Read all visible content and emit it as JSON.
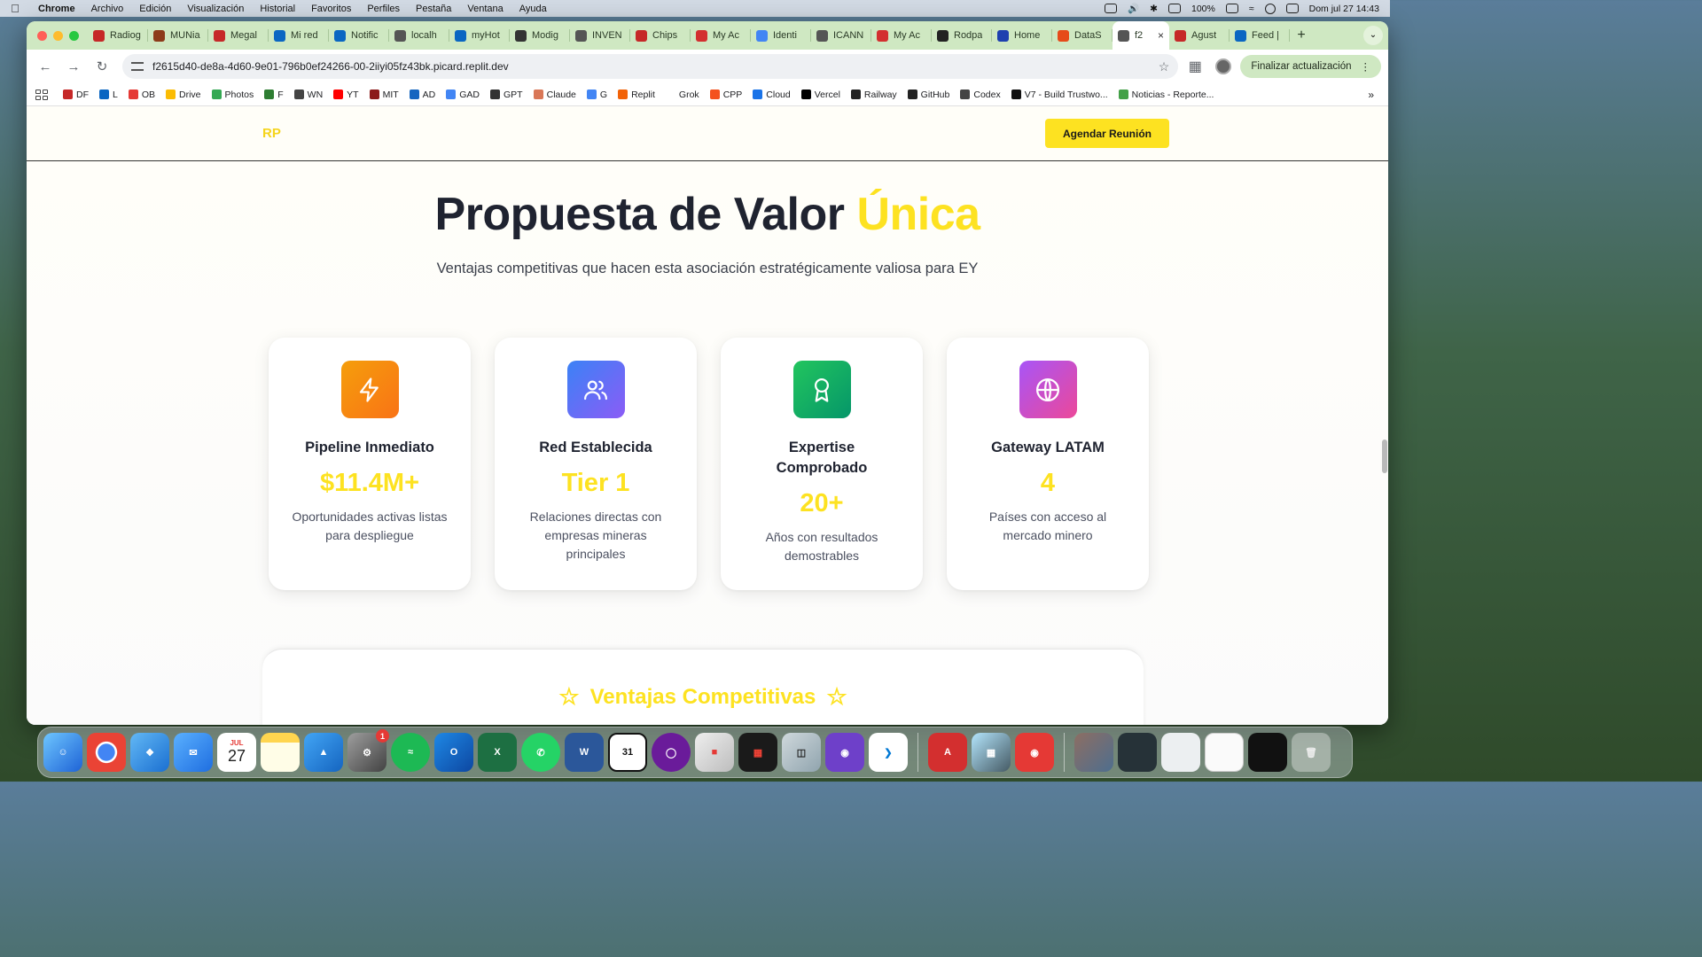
{
  "menubar": {
    "app": "Chrome",
    "items": [
      "Archivo",
      "Edición",
      "Visualización",
      "Historial",
      "Favoritos",
      "Perfiles",
      "Pestaña",
      "Ventana",
      "Ayuda"
    ],
    "battery": "100%",
    "datetime": "Dom jul 27  14:43"
  },
  "tabs": [
    {
      "label": "Radiog",
      "color": "#c62828"
    },
    {
      "label": "MUNia",
      "color": "#8d3b1a"
    },
    {
      "label": "Megal",
      "color": "#c62828"
    },
    {
      "label": "Mi red",
      "color": "#0a66c2"
    },
    {
      "label": "Notific",
      "color": "#0a66c2"
    },
    {
      "label": "localh",
      "color": "#555555"
    },
    {
      "label": "myHot",
      "color": "#0a66c2"
    },
    {
      "label": "Modig",
      "color": "#333333"
    },
    {
      "label": "INVEN",
      "color": "#555555"
    },
    {
      "label": "Chips",
      "color": "#c62828"
    },
    {
      "label": "My Ac",
      "color": "#d32f2f"
    },
    {
      "label": "Identi",
      "color": "#4285f4"
    },
    {
      "label": "ICANN",
      "color": "#555555"
    },
    {
      "label": "My Ac",
      "color": "#d32f2f"
    },
    {
      "label": "Rodpa",
      "color": "#222222"
    },
    {
      "label": "Home",
      "color": "#1e40af"
    },
    {
      "label": "DataS",
      "color": "#e64a19"
    },
    {
      "label": "f2",
      "color": "#555555",
      "active": true
    },
    {
      "label": "Agust",
      "color": "#c62828"
    },
    {
      "label": "Feed |",
      "color": "#0a66c2"
    }
  ],
  "toolbar": {
    "url": "f2615d40-de8a-4d60-9e01-796b0ef24266-00-2iiyi05fz43bk.picard.replit.dev",
    "update_label": "Finalizar actualización"
  },
  "bookmarks": [
    {
      "label": "DF",
      "color": "#c62828"
    },
    {
      "label": "L",
      "color": "#0a66c2"
    },
    {
      "label": "OB",
      "color": "#e53935"
    },
    {
      "label": "Drive",
      "color": "#fbbc04"
    },
    {
      "label": "Photos",
      "color": "#34a853"
    },
    {
      "label": "F",
      "color": "#2e7d32"
    },
    {
      "label": "WN",
      "color": "#444444"
    },
    {
      "label": "YT",
      "color": "#ff0000"
    },
    {
      "label": "MIT",
      "color": "#8b1a1a"
    },
    {
      "label": "AD",
      "color": "#1565c0"
    },
    {
      "label": "GAD",
      "color": "#4285f4"
    },
    {
      "label": "GPT",
      "color": "#333333"
    },
    {
      "label": "Claude",
      "color": "#d97757"
    },
    {
      "label": "G",
      "color": "#4285f4"
    },
    {
      "label": "Replit",
      "color": "#f26207"
    },
    {
      "label": "Grok",
      "color": "#ffffff"
    },
    {
      "label": "CPP",
      "color": "#f4511e"
    },
    {
      "label": "Cloud",
      "color": "#1a73e8"
    },
    {
      "label": "Vercel",
      "color": "#000000"
    },
    {
      "label": "Railway",
      "color": "#222222"
    },
    {
      "label": "GitHub",
      "color": "#222222"
    },
    {
      "label": "Codex",
      "color": "#444444"
    },
    {
      "label": "V7 - Build Trustwo...",
      "color": "#111111"
    },
    {
      "label": "Noticias - Reporte...",
      "color": "#43a047"
    }
  ],
  "site": {
    "logo": "RP",
    "cta_label": "Agendar Reunión",
    "heading_main": "Propuesta de Valor ",
    "heading_highlight": "Única",
    "subtitle": "Ventajas competitivas que hacen esta asociación estratégicamente valiosa para EY",
    "cards": [
      {
        "title": "Pipeline Inmediato",
        "value": "$11.4M+",
        "description": "Oportunidades activas listas para despliegue",
        "icon": "lightning-icon"
      },
      {
        "title": "Red Establecida",
        "value": "Tier 1",
        "description": "Relaciones directas con empresas mineras principales",
        "icon": "users-icon"
      },
      {
        "title": "Expertise Comprobado",
        "value": "20+",
        "description": "Años con resultados demostrables",
        "icon": "award-icon"
      },
      {
        "title": "Gateway LATAM",
        "value": "4",
        "description": "Países con acceso al mercado minero",
        "icon": "globe-icon"
      }
    ],
    "advantages_title": "Ventajas Competitivas"
  },
  "dock": {
    "calendar_month": "JUL",
    "calendar_day": "27",
    "settings_badge": "1"
  },
  "colors": {
    "accent_yellow": "#fde221",
    "heading_dark": "#1f2330",
    "chrome_tab_green": "#cfe8c2"
  }
}
